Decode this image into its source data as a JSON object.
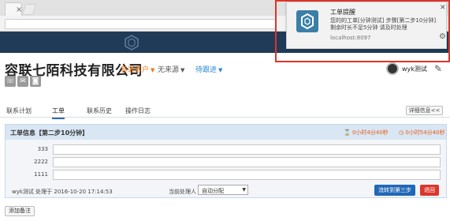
{
  "browser": {
    "tab_close": "×"
  },
  "company": {
    "name": "容联七陌科技有限公司",
    "type_dropdown": "普通客户",
    "source_dropdown": "无来源",
    "status_dropdown": "待跟进"
  },
  "contact_icons": [
    "phone-icon",
    "mail-icon",
    "chat-icon"
  ],
  "user": {
    "name": "wyk测试"
  },
  "tabs": [
    {
      "label": "联系计划",
      "active": false
    },
    {
      "label": "工单",
      "active": true
    },
    {
      "label": "联系历史",
      "active": false
    },
    {
      "label": "操作日志",
      "active": false
    }
  ],
  "detail_button": "详细信息<<",
  "ticket": {
    "title": "工单信息【第二步10分钟】",
    "timer_1": "0小时4分40秒",
    "timer_2": "0小时54分40秒",
    "fields": [
      {
        "label": "333",
        "value": ""
      },
      {
        "label": "2222",
        "value": ""
      },
      {
        "label": "1111",
        "value": ""
      }
    ],
    "meta": "wyk测试 处理于 2016-10-20 17:14:53",
    "handler_label": "当前处理人",
    "handler_value": "自动分配",
    "primary_button": "流转到第三步",
    "reject_button": "退回"
  },
  "add_note": "添加备注",
  "notification": {
    "title": "工单提醒",
    "line1": "您的的工单[分钟测试] 步骤[第二步10分钟]",
    "line2": "剩余时长不足5分钟 请及时处理",
    "host": "localhost:8097"
  },
  "colors": {
    "header": "#203b58",
    "accent_orange": "#e8791c",
    "accent_blue": "#2b8ad1",
    "primary_button": "#2168b6",
    "danger_button": "#d9372b",
    "highlight_frame": "#e03428"
  }
}
